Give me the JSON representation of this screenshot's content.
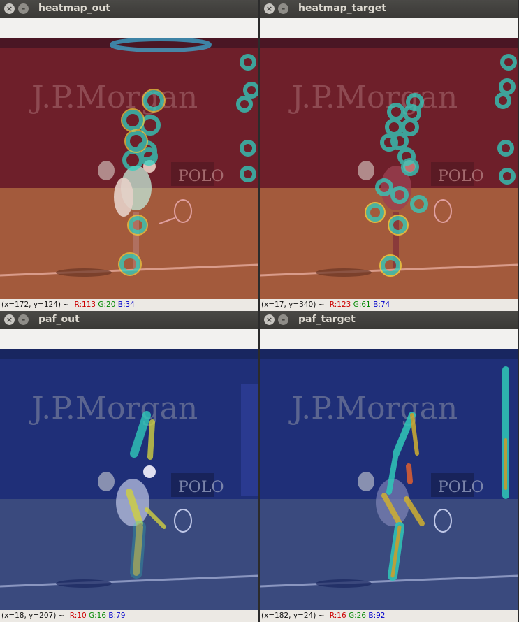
{
  "windows": [
    {
      "title": "heatmap_out",
      "theme": "red",
      "status": {
        "coords": "(x=172, y=124) ~",
        "r_label": "R:113",
        "g_label": "G:20",
        "b_label": "B:34"
      },
      "banner_text": "J.P.Morgan",
      "sign_text": "POLO"
    },
    {
      "title": "heatmap_target",
      "theme": "red",
      "status": {
        "coords": "(x=17, y=340) ~",
        "r_label": "R:123",
        "g_label": "G:61",
        "b_label": "B:74"
      },
      "banner_text": "J.P.Morgan",
      "sign_text": "POLO"
    },
    {
      "title": "paf_out",
      "theme": "blue",
      "status": {
        "coords": "(x=18, y=207) ~",
        "r_label": "R:10",
        "g_label": "G:16",
        "b_label": "B:79"
      },
      "banner_text": "J.P.Morgan",
      "sign_text": "POLO"
    },
    {
      "title": "paf_target",
      "theme": "blue",
      "status": {
        "coords": "(x=182, y=24) ~",
        "r_label": "R:16",
        "g_label": "G:26",
        "b_label": "B:92"
      },
      "banner_text": "J.P.Morgan",
      "sign_text": "POLO"
    }
  ],
  "colors": {
    "red_wall": "#6e1f2a",
    "red_court": "#a35a3c",
    "blue_wall": "#1f2f78",
    "blue_court": "#3a4a7e",
    "heat_ring": "#2fd0c0"
  },
  "window_controls": {
    "close_symbol": "×",
    "min_symbol": "–"
  }
}
